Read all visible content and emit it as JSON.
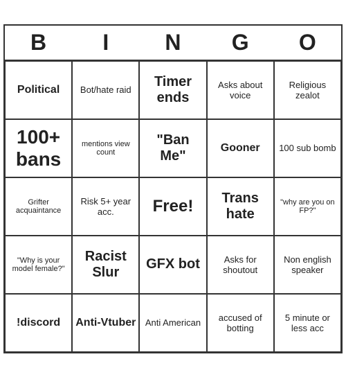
{
  "header": {
    "letters": [
      "B",
      "I",
      "N",
      "G",
      "O"
    ]
  },
  "cells": [
    {
      "text": "Political",
      "size": "medium"
    },
    {
      "text": "Bot/hate raid",
      "size": "normal"
    },
    {
      "text": "Timer ends",
      "size": "large"
    },
    {
      "text": "Asks about voice",
      "size": "normal"
    },
    {
      "text": "Religious zealot",
      "size": "normal"
    },
    {
      "text": "100+ bans",
      "size": "xlarge"
    },
    {
      "text": "mentions view count",
      "size": "small"
    },
    {
      "text": "\"Ban Me\"",
      "size": "large"
    },
    {
      "text": "Gooner",
      "size": "medium"
    },
    {
      "text": "100 sub bomb",
      "size": "normal"
    },
    {
      "text": "Grifter acquaintance",
      "size": "small"
    },
    {
      "text": "Risk 5+ year acc.",
      "size": "normal"
    },
    {
      "text": "Free!",
      "size": "free"
    },
    {
      "text": "Trans hate",
      "size": "large"
    },
    {
      "text": "\"why are you on FP?\"",
      "size": "small"
    },
    {
      "text": "\"Why is your model female?\"",
      "size": "small"
    },
    {
      "text": "Racist Slur",
      "size": "large"
    },
    {
      "text": "GFX bot",
      "size": "large"
    },
    {
      "text": "Asks for shoutout",
      "size": "normal"
    },
    {
      "text": "Non english speaker",
      "size": "normal"
    },
    {
      "text": "!discord",
      "size": "medium"
    },
    {
      "text": "Anti-Vtuber",
      "size": "medium"
    },
    {
      "text": "Anti American",
      "size": "normal"
    },
    {
      "text": "accused of botting",
      "size": "normal"
    },
    {
      "text": "5 minute or less acc",
      "size": "normal"
    }
  ]
}
